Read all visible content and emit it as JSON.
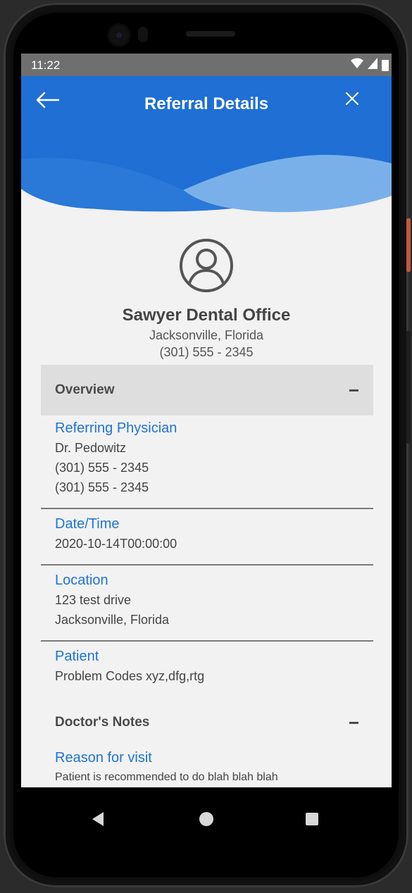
{
  "status_bar": {
    "time": "11:22",
    "icons": [
      "wifi-icon",
      "signal-icon",
      "battery-icon"
    ]
  },
  "header": {
    "title": "Referral Details",
    "back_icon": "arrow-left-icon",
    "close_icon": "close-icon"
  },
  "office": {
    "name": "Sawyer Dental Office",
    "city": "Jacksonville, Florida",
    "phone": "(301) 555 - 2345",
    "icon": "user-circle-icon"
  },
  "overview": {
    "title": "Overview",
    "toggle": "−",
    "referring_physician": {
      "label": "Referring Physician",
      "name": "Dr. Pedowitz",
      "phone1": "(301) 555 - 2345",
      "phone2": "(301) 555 - 2345"
    },
    "date_time": {
      "label": "Date/Time",
      "value": "2020-10-14T00:00:00"
    },
    "location": {
      "label": "Location",
      "line1": "123 test drive",
      "line2": "Jacksonville, Florida"
    },
    "patient": {
      "label": "Patient",
      "value": "Problem Codes xyz,dfg,rtg"
    }
  },
  "doctors_notes": {
    "title": "Doctor's Notes",
    "toggle": "−",
    "reason": {
      "label": "Reason for visit",
      "value": "Patient is recommended to do blah blah blah"
    }
  },
  "nav_bar": {
    "icons": [
      "nav-back-icon",
      "nav-home-icon",
      "nav-recent-icon"
    ]
  },
  "colors": {
    "primary_blue": "#1f74d4",
    "header_blue": "#1f6fd4",
    "wave_light": "#7ab0ea",
    "background": "#f2f2f2"
  }
}
